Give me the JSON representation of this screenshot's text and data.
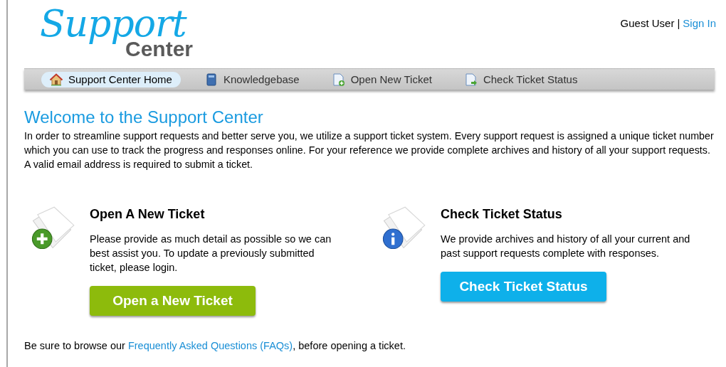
{
  "logo": {
    "script_text": "Support",
    "block_text": "Center"
  },
  "user_bar": {
    "user": "Guest User",
    "separator": "|",
    "link": "Sign In"
  },
  "nav": [
    {
      "label": "Support Center Home",
      "kind": "home",
      "selected": true
    },
    {
      "label": "Knowledgebase",
      "kind": "book",
      "selected": false
    },
    {
      "label": "Open New Ticket",
      "kind": "newdoc",
      "selected": false
    },
    {
      "label": "Check Ticket Status",
      "kind": "statusdoc",
      "selected": false
    }
  ],
  "welcome": {
    "title": "Welcome to the Support Center",
    "text": "In order to streamline support requests and better serve you, we utilize a support ticket system. Every support request is assigned a unique ticket number which you can use to track the progress and responses online. For your reference we provide complete archives and history of all your support requests. A valid email address is required to submit a ticket."
  },
  "cards": [
    {
      "kind": "new",
      "title": "Open A New Ticket",
      "text": "Please provide as much detail as possible so we can best assist you. To update a previously submitted ticket, please login.",
      "button": "Open a New Ticket",
      "color": "#8dbb0c"
    },
    {
      "kind": "status",
      "title": "Check Ticket Status",
      "text": "We provide archives and history of all your current and past support requests complete with responses.",
      "button": "Check Ticket Status",
      "color": "#0eb0ea"
    }
  ],
  "footer": {
    "before": "Be sure to browse our",
    "link": "Frequently Asked Questions (FAQs)",
    "after": ", before opening a ticket."
  }
}
